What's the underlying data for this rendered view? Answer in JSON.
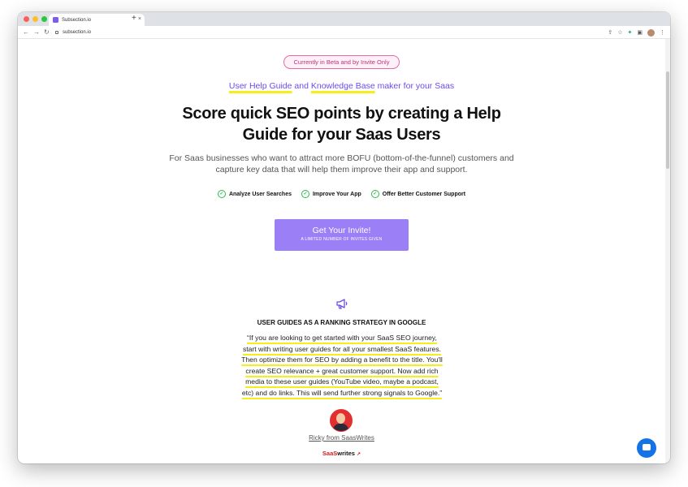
{
  "browser": {
    "tab_title": "Subsection.io",
    "url": "subsection.io",
    "new_tab": "+",
    "tab_close": "×",
    "back": "←",
    "forward": "→",
    "reload": "↻",
    "share": "⇪",
    "bookmark": "☆",
    "extensions": "✦",
    "menu": "⋮"
  },
  "hero": {
    "beta_badge": "Currently in Beta and by Invite Only",
    "tagline_part1": "User Help Guide",
    "tagline_and": "and",
    "tagline_part2": "Knowledge Base",
    "tagline_rest": "maker for your Saas",
    "headline_line1": "Score quick SEO points by creating a Help",
    "headline_line2": "Guide for your Saas Users",
    "subtext_line1": "For Saas businesses who want to attract more BOFU (bottom-of-the-funnel) customers and",
    "subtext_line2": "capture key data that will help them improve their app and support.",
    "features": [
      "Analyze User Searches",
      "Improve Your App",
      "Offer Better Customer Support"
    ],
    "cta_main": "Get Your Invite!",
    "cta_sub": "A LIMITED NUMBER OF INVITES GIVEN"
  },
  "testimonial": {
    "title": "USER GUIDES AS A RANKING STRATEGY IN GOOGLE",
    "quote_lines": [
      "“If you are looking to get started with your SaaS SEO journey,",
      "start with writing user guides for all your smallest SaaS features.",
      "Then optimize them for SEO by adding a benefit to the title. You'll",
      "create SEO relevance + great customer support. Now add rich",
      "media to these user guides (YouTube video, maybe a podcast,",
      "etc) and do links. This will send further strong signals to Google.”"
    ],
    "author": "Ricky from SaasWrites",
    "brand_saas": "SaaS",
    "brand_writes": "writes",
    "brand_mark": "↗"
  },
  "colors": {
    "accent": "#6d4bf0",
    "cta": "#9a7ff7",
    "highlight": "#f4ee1a",
    "check": "#2eb84f",
    "chat": "#1473e6"
  },
  "icons": [
    "check-circle-icon",
    "megaphone-icon",
    "chat-icon",
    "lock-icon"
  ]
}
